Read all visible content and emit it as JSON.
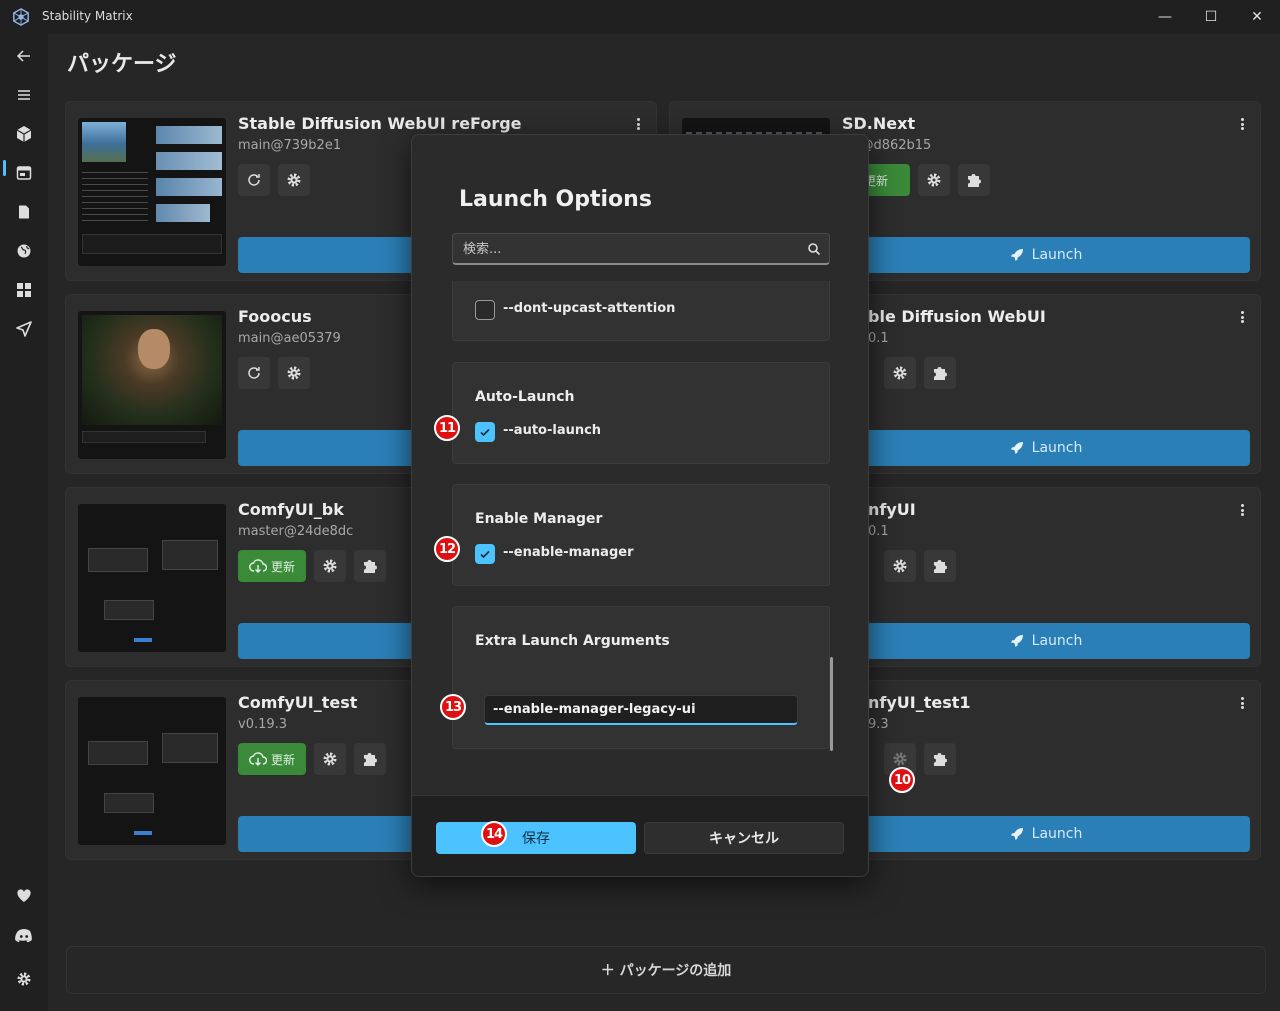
{
  "window": {
    "title": "Stability Matrix",
    "controls": {
      "minimize": "—",
      "maximize": "☐",
      "close": "✕"
    }
  },
  "page": {
    "title": "パッケージ"
  },
  "sidebar": {
    "top_icons": [
      "back-arrow-icon",
      "menu-icon",
      "packages-icon",
      "browser-icon",
      "model-file-icon",
      "web-icon",
      "grid-icon",
      "send-icon"
    ],
    "bottom_icons": [
      "heart-icon",
      "discord-icon",
      "settings-gear-icon"
    ],
    "active_index": 2
  },
  "packages": [
    {
      "name": "Stable Diffusion WebUI reForge",
      "version": "main@739b2e1",
      "update_label": "",
      "launch_label": ""
    },
    {
      "name": "SD.Next",
      "version": "ter@d862b15",
      "update_label": "更新",
      "launch_label": "Launch"
    },
    {
      "name": "Fooocus",
      "version": "main@ae05379",
      "update_label": "",
      "launch_label": ""
    },
    {
      "name": "ble Diffusion WebUI",
      "version": "0.1",
      "update_label": "",
      "launch_label": "Launch"
    },
    {
      "name": "ComfyUI_bk",
      "version": "master@24de8dc",
      "update_label": "更新",
      "launch_label": ""
    },
    {
      "name": "nfyUI",
      "version": "0.1",
      "update_label": "",
      "launch_label": "Launch"
    },
    {
      "name": "ComfyUI_test",
      "version": "v0.19.3",
      "update_label": "更新",
      "launch_label": ""
    },
    {
      "name": "nfyUI_test1",
      "version": "9.3",
      "update_label": "",
      "launch_label": "Launch"
    }
  ],
  "add_package": {
    "label": "＋ パッケージの追加"
  },
  "dialog": {
    "title": "Launch Options",
    "search_placeholder": "検索...",
    "options": [
      {
        "title": "",
        "checkbox_label": "--dont-upcast-attention",
        "checked": false
      },
      {
        "title": "Auto-Launch",
        "checkbox_label": "--auto-launch",
        "checked": true
      },
      {
        "title": "Enable Manager",
        "checkbox_label": "--enable-manager",
        "checked": true
      }
    ],
    "extra": {
      "title": "Extra Launch Arguments",
      "value": "--enable-manager-legacy-ui"
    },
    "save_label": "保存",
    "cancel_label": "キャンセル"
  },
  "markers": [
    "10",
    "11",
    "12",
    "13",
    "14"
  ],
  "colors": {
    "accent": "#4cc2ff",
    "launch": "#2b7fb7",
    "update": "#3a8a3a",
    "marker": "#e01010"
  }
}
